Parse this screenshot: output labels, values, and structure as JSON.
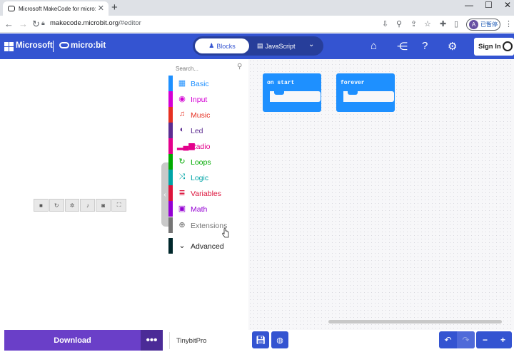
{
  "browser": {
    "tab_title": "Microsoft MakeCode for micro:bit",
    "tab_close": "✕",
    "new_tab": "+",
    "url_host": "makecode.microbit.org",
    "url_path": "/#editor",
    "profile_initial": "A",
    "profile_label": "已暫停",
    "window_min": "—",
    "window_max": "☐",
    "window_close": "✕"
  },
  "header": {
    "brand": "Microsoft",
    "product": "micro:bit",
    "tabs": [
      {
        "label": "Blocks",
        "icon": "puzzle-icon",
        "active": true
      },
      {
        "label": "JavaScript",
        "icon": "js-icon",
        "active": false
      }
    ],
    "signin_label": "Sign In",
    "accent": "#3454d1"
  },
  "toolbox": {
    "search_placeholder": "Search...",
    "categories": [
      {
        "label": "Basic",
        "color": "#1e90ff",
        "icon": "grid-icon"
      },
      {
        "label": "Input",
        "color": "#d400d4",
        "icon": "circle-dot-icon"
      },
      {
        "label": "Music",
        "color": "#e63022",
        "icon": "headphones-icon"
      },
      {
        "label": "Led",
        "color": "#5c2d91",
        "icon": "toggle-icon"
      },
      {
        "label": "Radio",
        "color": "#e3008c",
        "icon": "signal-bars-icon"
      },
      {
        "label": "Loops",
        "color": "#00aa00",
        "icon": "refresh-icon"
      },
      {
        "label": "Logic",
        "color": "#00a4a6",
        "icon": "shuffle-icon"
      },
      {
        "label": "Variables",
        "color": "#dc143c",
        "icon": "list-icon"
      },
      {
        "label": "Math",
        "color": "#9400d3",
        "icon": "calculator-icon"
      },
      {
        "label": "Extensions",
        "color": "#757575",
        "icon": "plus-circle-icon"
      },
      {
        "label": "Advanced",
        "color": "#00272b",
        "icon": "chevron-down-icon"
      }
    ]
  },
  "workspace": {
    "blocks": [
      {
        "label": "on start"
      },
      {
        "label": "forever"
      }
    ],
    "block_color": "#1e90ff"
  },
  "bottom": {
    "download_label": "Download",
    "more_label": "•••",
    "project_name": "TinybitPro",
    "download_color": "#6a3fc8"
  }
}
